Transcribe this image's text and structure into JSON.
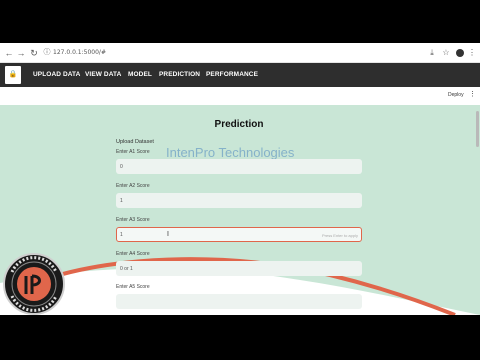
{
  "browser": {
    "url": "127.0.0.1:5000/#",
    "icons": [
      "back-arrow-icon",
      "forward-arrow-icon",
      "reload-icon",
      "info-icon"
    ]
  },
  "navbar": {
    "items": [
      {
        "label": "UPLOAD DATA"
      },
      {
        "label": "VIEW DATA"
      },
      {
        "label": "MODEL"
      },
      {
        "label": "PREDICTION"
      },
      {
        "label": "PERFORMANCE"
      }
    ]
  },
  "toolbar": {
    "deploy_label": "Deploy"
  },
  "main": {
    "title": "Prediction",
    "watermark": "IntenPro Technologies",
    "upload_label": "Upload Dataset",
    "fields": [
      {
        "label": "Enter A1 Score",
        "value": "0",
        "hint": ""
      },
      {
        "label": "Enter A2 Score",
        "value": "1",
        "hint": ""
      },
      {
        "label": "Enter A3 Score",
        "value": "1",
        "hint": "Press Enter to apply"
      },
      {
        "label": "Enter A4 Score",
        "value": "0 or 1",
        "hint": ""
      },
      {
        "label": "Enter A5 Score",
        "value": "",
        "hint": ""
      }
    ]
  },
  "colors": {
    "accent": "#e0664b",
    "background": "#c9e6d6",
    "navbar": "#2e2e2e"
  }
}
